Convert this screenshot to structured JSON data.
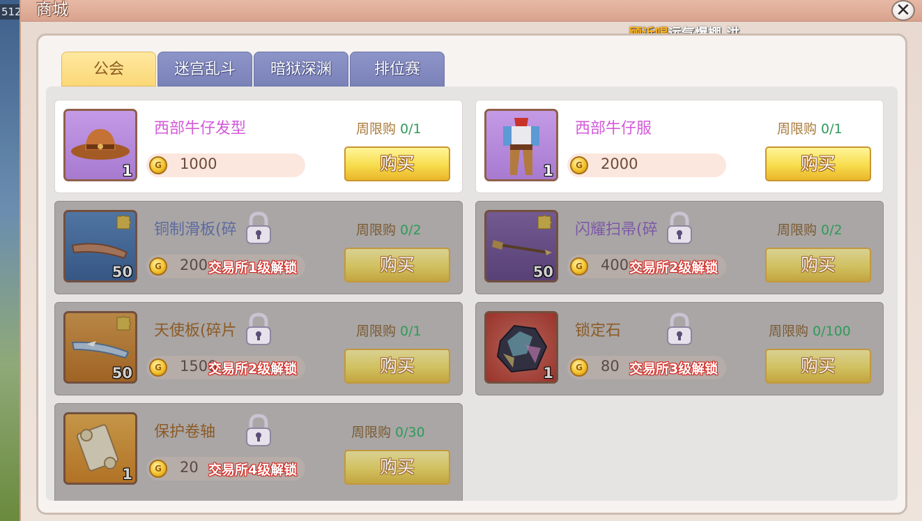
{
  "background": {
    "tag": "512"
  },
  "window": {
    "title": "商城",
    "close_label": "✕",
    "notice": {
      "name": "顾诉喝",
      "message": "运气爆棚,洪"
    }
  },
  "tabs": [
    {
      "label": "公会",
      "active": true
    },
    {
      "label": "迷宫乱斗",
      "active": false
    },
    {
      "label": "暗狱深渊",
      "active": false
    },
    {
      "label": "排位赛",
      "active": false
    }
  ],
  "items": [
    {
      "name": "西部牛仔发型",
      "limit_label": "周限购",
      "limit_count": "0/1",
      "price": "1000",
      "quantity": "1",
      "buy_label": "购买",
      "locked": false,
      "unlock_text": "",
      "icon": "cowboy-hat-icon",
      "icon_bg": "purple",
      "fragment": false
    },
    {
      "name": "西部牛仔服",
      "limit_label": "周限购",
      "limit_count": "0/1",
      "price": "2000",
      "quantity": "1",
      "buy_label": "购买",
      "locked": false,
      "unlock_text": "",
      "icon": "cowboy-outfit-icon",
      "icon_bg": "purple",
      "fragment": false
    },
    {
      "name": "铜制滑板(碎",
      "limit_label": "周限购",
      "limit_count": "0/2",
      "price": "200",
      "quantity": "50",
      "buy_label": "购买",
      "locked": true,
      "unlock_text": "交易所1级解锁",
      "icon": "copper-skateboard-icon",
      "icon_bg": "blue",
      "fragment": true
    },
    {
      "name": "闪耀扫帚(碎",
      "limit_label": "周限购",
      "limit_count": "0/2",
      "price": "400",
      "quantity": "50",
      "buy_label": "购买",
      "locked": true,
      "unlock_text": "交易所2级解锁",
      "icon": "broom-icon",
      "icon_bg": "purple",
      "fragment": true
    },
    {
      "name": "天使板(碎片",
      "limit_label": "周限购",
      "limit_count": "0/1",
      "price": "1500",
      "quantity": "50",
      "buy_label": "购买",
      "locked": true,
      "unlock_text": "交易所2级解锁",
      "icon": "angel-board-icon",
      "icon_bg": "orange",
      "fragment": true
    },
    {
      "name": "锁定石",
      "limit_label": "周限购",
      "limit_count": "0/100",
      "price": "80",
      "quantity": "1",
      "buy_label": "购买",
      "locked": true,
      "unlock_text": "交易所3级解锁",
      "icon": "lock-stone-icon",
      "icon_bg": "red",
      "fragment": false
    },
    {
      "name": "保护卷轴",
      "limit_label": "周限购",
      "limit_count": "0/30",
      "price": "20",
      "quantity": "1",
      "buy_label": "购买",
      "locked": true,
      "unlock_text": "交易所4级解锁",
      "icon": "scroll-icon",
      "icon_bg": "gold",
      "fragment": false
    }
  ],
  "colors": {
    "item_name": "#d35ad8",
    "limit_count": "#2f9a59",
    "unlock_outline": "#d4261f",
    "tab_active": "#fbd877",
    "tab_inactive": "#7a82b8"
  }
}
